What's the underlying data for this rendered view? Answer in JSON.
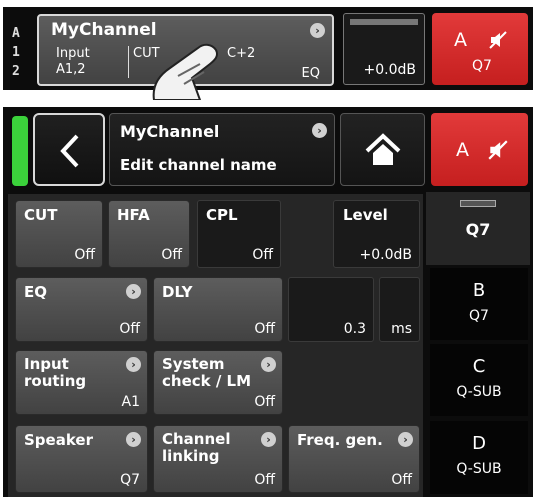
{
  "top": {
    "side_labels": [
      "A",
      "1",
      "2"
    ],
    "channel_name": "MyChannel",
    "row_labels": [
      "Input",
      "CUT",
      "C+2"
    ],
    "input_value": "A1,2",
    "eq_label": "EQ",
    "level": "+0.0dB",
    "alert_letter": "A",
    "alert_preset": "Q7"
  },
  "header": {
    "title": "MyChannel",
    "subtitle": "Edit channel name",
    "alert_letter": "A"
  },
  "toggles": [
    {
      "label": "CUT",
      "value": "Off"
    },
    {
      "label": "HFA",
      "value": "Off"
    },
    {
      "label": "CPL",
      "value": "Off"
    }
  ],
  "level": {
    "label": "Level",
    "value": "+0.0dB"
  },
  "eq": {
    "label": "EQ",
    "value": "Off"
  },
  "dly": {
    "label": "DLY",
    "value": "Off",
    "amount": "0.3",
    "unit": "ms"
  },
  "input_routing": {
    "line1": "Input",
    "line2": "routing",
    "value": "A1"
  },
  "system_check": {
    "line1": "System",
    "line2": "check / LM",
    "value": "Off"
  },
  "speaker": {
    "label": "Speaker",
    "value": "Q7"
  },
  "channel_linking": {
    "line1": "Channel",
    "line2": "linking",
    "value": "Off"
  },
  "freq_gen": {
    "label": "Freq. gen.",
    "value": "Off"
  },
  "channels": [
    {
      "letter": "",
      "preset": "Q7"
    },
    {
      "letter": "B",
      "preset": "Q7"
    },
    {
      "letter": "C",
      "preset": "Q-SUB"
    },
    {
      "letter": "D",
      "preset": "Q-SUB"
    }
  ],
  "colors": {
    "accent_red": "#d42a2a",
    "status_green": "#3bd23b"
  },
  "icons": [
    "finger-tap-icon",
    "mute-speaker-icon",
    "back-chevron-icon",
    "home-icon",
    "arrow-right-icon"
  ]
}
